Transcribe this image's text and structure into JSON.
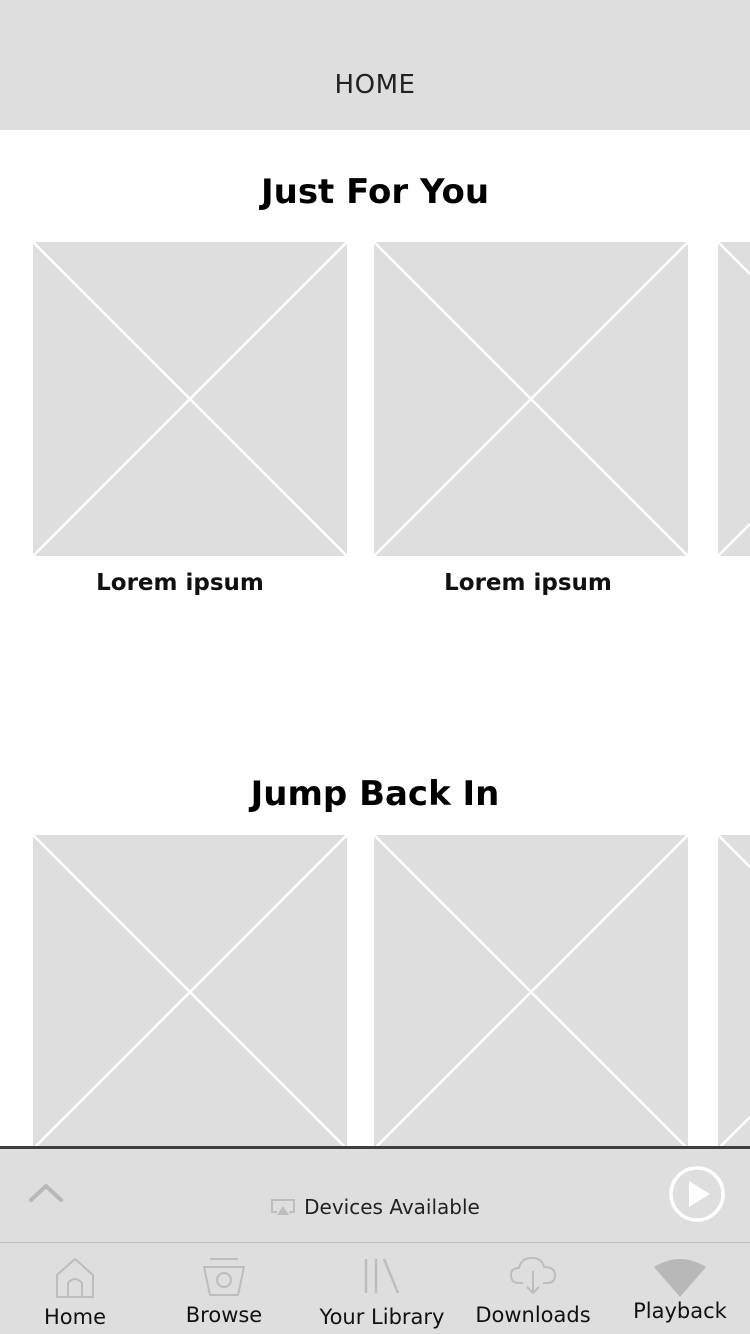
{
  "header": {
    "title": "HOME"
  },
  "sections": [
    {
      "title": "Just For You",
      "cards": [
        {
          "label": "Lorem ipsum"
        },
        {
          "label": "Lorem ipsum"
        }
      ]
    },
    {
      "title": "Jump Back In"
    }
  ],
  "mini_player": {
    "devices_label": "Devices Available",
    "expand_icon": "chevron-up-icon",
    "device_icon": "airplay-icon",
    "play_icon": "play-icon"
  },
  "tab_bar": {
    "tabs": [
      {
        "label": "Home",
        "icon": "home-icon"
      },
      {
        "label": "Browse",
        "icon": "browse-icon"
      },
      {
        "label": "Your Library",
        "icon": "library-icon"
      },
      {
        "label": "Downloads",
        "icon": "download-cloud-icon"
      },
      {
        "label": "Playback",
        "icon": "playback-icon"
      }
    ]
  },
  "colors": {
    "placeholder": "#dedede",
    "header": "#dedede",
    "divider": "#3e3e3e",
    "icon": "#bdbdbd"
  }
}
